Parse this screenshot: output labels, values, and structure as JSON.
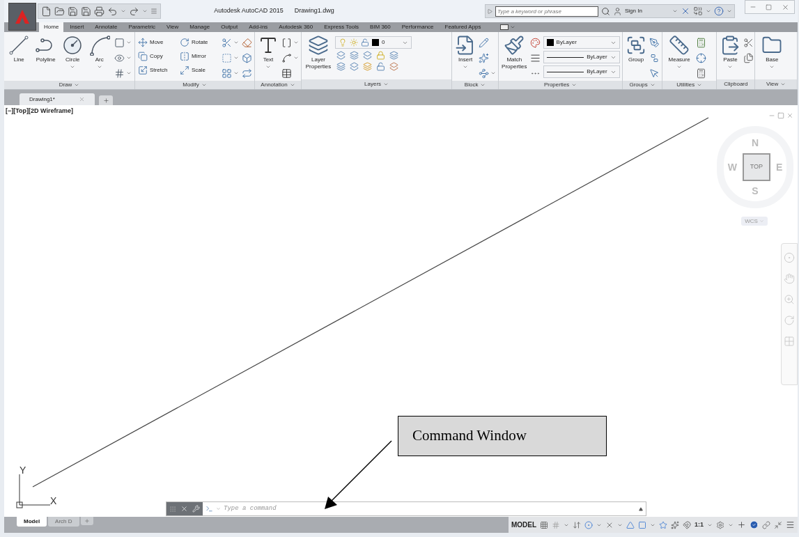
{
  "window": {
    "app_title": "Autodesk AutoCAD 2015",
    "file_name": "Drawing1.dwg"
  },
  "search": {
    "placeholder": "Type a keyword or phrase"
  },
  "sign_in": "Sign In",
  "ribbon_tabs": [
    {
      "label": "Home",
      "selected": true
    },
    {
      "label": "Insert",
      "selected": false
    },
    {
      "label": "Annotate",
      "selected": false
    },
    {
      "label": "Parametric",
      "selected": false
    },
    {
      "label": "View",
      "selected": false
    },
    {
      "label": "Manage",
      "selected": false
    },
    {
      "label": "Output",
      "selected": false
    },
    {
      "label": "Add-ins",
      "selected": false
    },
    {
      "label": "Autodesk 360",
      "selected": false
    },
    {
      "label": "Express Tools",
      "selected": false
    },
    {
      "label": "BIM 360",
      "selected": false
    },
    {
      "label": "Performance",
      "selected": false
    },
    {
      "label": "Featured Apps",
      "selected": false
    }
  ],
  "ribbon_panels": [
    {
      "title": "Draw",
      "has_menu": true,
      "tools": [
        {
          "kind": "large",
          "label": "Line",
          "dropdown": false
        },
        {
          "kind": "large",
          "label": "Polyline",
          "dropdown": false
        },
        {
          "kind": "large",
          "label": "Circle",
          "dropdown": true
        },
        {
          "kind": "large",
          "label": "Arc",
          "dropdown": true
        }
      ]
    },
    {
      "title": "Modify",
      "has_menu": true,
      "tools": [
        {
          "kind": "small",
          "label": "Move"
        },
        {
          "kind": "small",
          "label": "Copy"
        },
        {
          "kind": "small",
          "label": "Stretch"
        },
        {
          "kind": "small",
          "label": "Rotate"
        },
        {
          "kind": "small",
          "label": "Mirror"
        },
        {
          "kind": "small",
          "label": "Scale"
        }
      ]
    },
    {
      "title": "Annotation",
      "has_menu": true,
      "tools": [
        {
          "kind": "large",
          "label": "Text",
          "dropdown": true
        }
      ]
    },
    {
      "title": "Layers",
      "has_menu": true,
      "tools": [
        {
          "kind": "large",
          "label": "Layer Properties",
          "dropdown": false
        },
        {
          "kind": "layer-dropdown",
          "value": "0"
        }
      ]
    },
    {
      "title": "Block",
      "has_menu": true,
      "tools": [
        {
          "kind": "large",
          "label": "Insert",
          "dropdown": true
        }
      ]
    },
    {
      "title": "Properties",
      "has_menu": true,
      "tools": [
        {
          "kind": "large",
          "label": "Match Properties",
          "dropdown": false
        },
        {
          "kind": "color-dropdown",
          "value": "ByLayer"
        },
        {
          "kind": "line-dropdown",
          "value": "ByLayer"
        },
        {
          "kind": "line-dropdown",
          "value": "ByLayer"
        }
      ]
    },
    {
      "title": "Groups",
      "has_menu": true,
      "tools": [
        {
          "kind": "large",
          "label": "Group",
          "dropdown": false
        }
      ]
    },
    {
      "title": "Utilities",
      "has_menu": true,
      "tools": [
        {
          "kind": "large",
          "label": "Measure",
          "dropdown": true
        }
      ]
    },
    {
      "title": "Clipboard",
      "has_menu": false,
      "tools": [
        {
          "kind": "large",
          "label": "Paste",
          "dropdown": true
        }
      ]
    },
    {
      "title": "View",
      "has_menu": true,
      "tools": [
        {
          "kind": "large",
          "label": "Base",
          "dropdown": true
        }
      ]
    }
  ],
  "file_tabs": [
    {
      "label": "Drawing1*",
      "selected": true
    }
  ],
  "viewport_label": "[−][Top][2D Wireframe]",
  "viewcube": {
    "north": "N",
    "west": "W",
    "face": "TOP",
    "east": "E",
    "south": "S",
    "coordinate_system": "WCS"
  },
  "ucs_icon": {
    "y_label": "Y",
    "x_label": "X"
  },
  "callout": "Command Window",
  "command_line": {
    "placeholder": "Type a command"
  },
  "layout_tabs": [
    {
      "label": "Model",
      "selected": true
    },
    {
      "label": "Arch D",
      "selected": false
    }
  ],
  "status_bar": {
    "space": "MODEL",
    "annotation_scale": "1:1"
  }
}
